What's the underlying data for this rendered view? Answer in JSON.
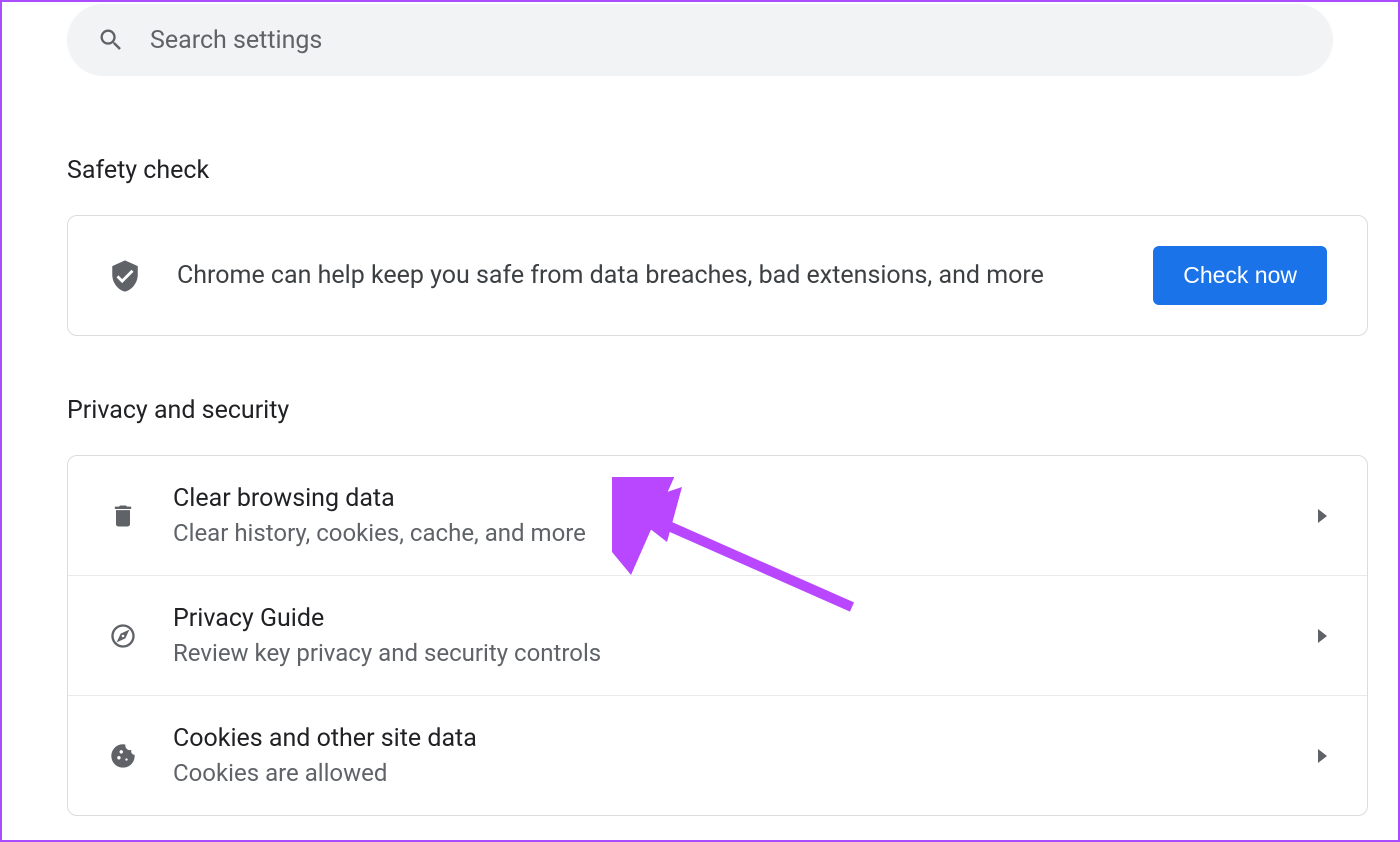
{
  "search": {
    "placeholder": "Search settings"
  },
  "safety_check": {
    "title": "Safety check",
    "description": "Chrome can help keep you safe from data breaches, bad extensions, and more",
    "button_label": "Check now"
  },
  "privacy": {
    "title": "Privacy and security",
    "rows": [
      {
        "title": "Clear browsing data",
        "subtitle": "Clear history, cookies, cache, and more"
      },
      {
        "title": "Privacy Guide",
        "subtitle": "Review key privacy and security controls"
      },
      {
        "title": "Cookies and other site data",
        "subtitle": "Cookies are allowed"
      }
    ]
  }
}
